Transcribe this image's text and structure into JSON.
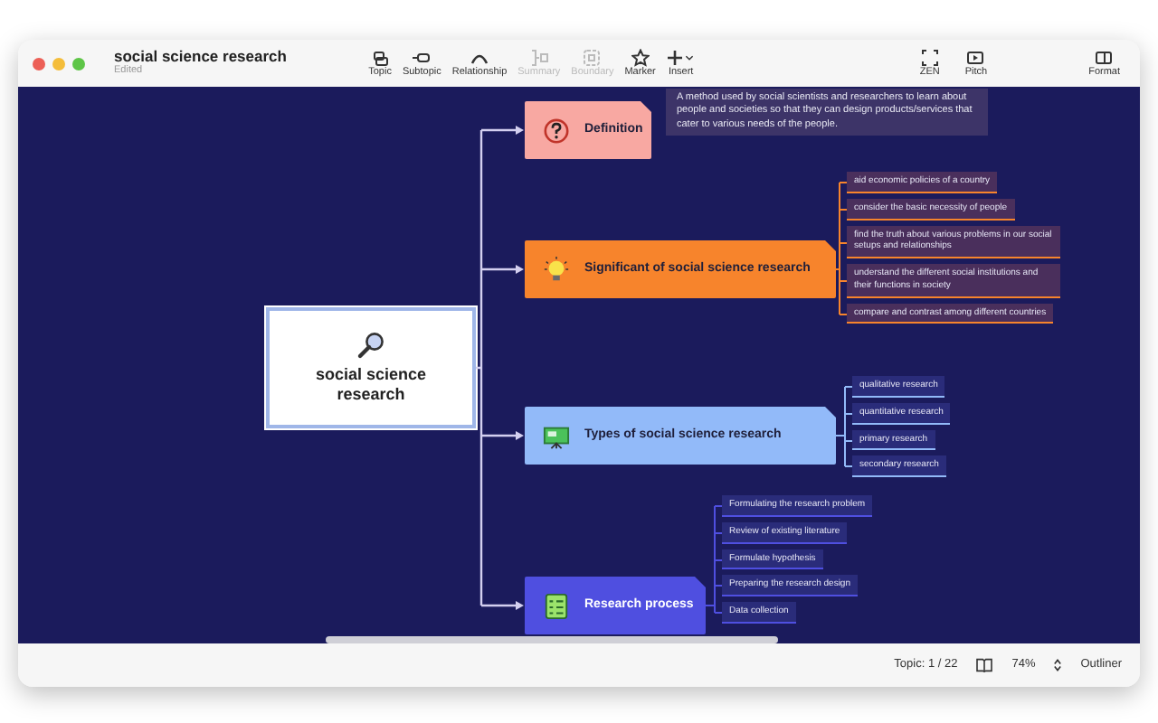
{
  "window": {
    "title": "social science research",
    "subtitle": "Edited"
  },
  "toolbar": {
    "center": [
      {
        "label": "Topic",
        "kind": "topic",
        "disabled": false
      },
      {
        "label": "Subtopic",
        "kind": "subtopic",
        "disabled": false
      },
      {
        "label": "Relationship",
        "kind": "relationship",
        "disabled": false
      },
      {
        "label": "Summary",
        "kind": "summary",
        "disabled": true
      },
      {
        "label": "Boundary",
        "kind": "boundary",
        "disabled": true
      },
      {
        "label": "Marker",
        "kind": "marker",
        "disabled": false
      },
      {
        "label": "Insert",
        "kind": "insert",
        "disabled": false,
        "dropdown": true
      }
    ],
    "right": [
      {
        "label": "ZEN",
        "kind": "zen",
        "disabled": false
      },
      {
        "label": "Pitch",
        "kind": "pitch",
        "disabled": false
      }
    ],
    "end": [
      {
        "label": "Format",
        "kind": "format",
        "disabled": false
      }
    ]
  },
  "mindmap": {
    "root": {
      "title": "social science research",
      "selected": true
    },
    "branches": [
      {
        "title": "Definition",
        "kind": "question",
        "color": "#f8a8a2",
        "note": "A method used by social scientists and researchers to learn about people and societies so that they can design products/services that cater to various needs of the people."
      },
      {
        "title": "Significant of social science research",
        "kind": "bulb",
        "color": "#f7842c",
        "children": [
          "aid economic policies of a country",
          "consider the basic necessity of people",
          "find the truth about various problems in our social setups and relationships",
          "understand the different social institutions and their functions in society",
          "compare and contrast among different countries"
        ]
      },
      {
        "title": "Types of social science research",
        "kind": "board",
        "color": "#92baf9",
        "children": [
          "qualitative research",
          "quantitative research",
          "primary research",
          "secondary research"
        ]
      },
      {
        "title": "Research process",
        "kind": "checklist",
        "color": "#4f4fe0",
        "children": [
          "Formulating the research problem",
          "Review of existing literature",
          "Formulate hypothesis",
          "Preparing the research design",
          "Data collection"
        ]
      }
    ]
  },
  "status_bar": {
    "topic_count": "Topic: 1 / 22",
    "zoom": "74%",
    "outliner": "Outliner"
  }
}
